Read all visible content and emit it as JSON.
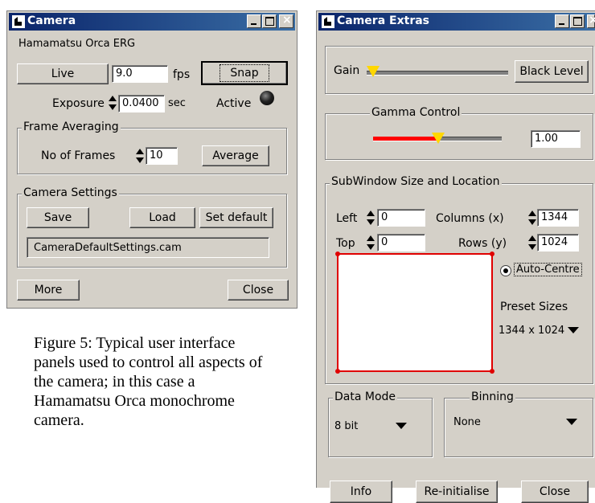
{
  "camera": {
    "title": "Camera",
    "camera_name": "Hamamatsu Orca ERG",
    "live_label": "Live",
    "fps_value": "9.0",
    "fps_unit": "fps",
    "snap_label": "Snap",
    "exposure_label": "Exposure",
    "exposure_value": "0.0400",
    "exposure_unit": "sec",
    "active_label": "Active",
    "frame_averaging": {
      "title": "Frame Averaging",
      "frames_label": "No of Frames",
      "frames_value": "10",
      "average_label": "Average"
    },
    "settings": {
      "title": "Camera Settings",
      "save_label": "Save",
      "load_label": "Load",
      "set_default_label": "Set default",
      "file": "CameraDefaultSettings.cam"
    },
    "more_label": "More",
    "close_label": "Close"
  },
  "extras": {
    "title": "Camera Extras",
    "gain_label": "Gain",
    "gain_level": 0,
    "black_level_label": "Black Level",
    "gamma": {
      "title": "Gamma Control",
      "value": "1.00",
      "slider_level": 0.5
    },
    "subwindow": {
      "title": "SubWindow Size and Location",
      "left_label": "Left",
      "left_value": "0",
      "top_label": "Top",
      "top_value": "0",
      "columns_label": "Columns (x)",
      "columns_value": "1344",
      "rows_label": "Rows (y)",
      "rows_value": "1024",
      "auto_centre_label": "Auto-Centre",
      "preset_label": "Preset Sizes",
      "preset_value": "1344 x 1024"
    },
    "data_mode": {
      "title": "Data Mode",
      "value": "8 bit"
    },
    "binning": {
      "title": "Binning",
      "value": "None"
    },
    "info_label": "Info",
    "reinit_label": "Re-initialise",
    "close_label": "Close"
  },
  "caption": "Figure 5: Typical user interface panels used to control all aspects of the camera; in this case a Hamamatsu Orca monochrome camera.",
  "colors": {
    "titlebar": "#0a246a",
    "gamma_fill": "#ff0000",
    "slider_thumb": "#ffd700",
    "subwindow_border": "#e00000"
  }
}
